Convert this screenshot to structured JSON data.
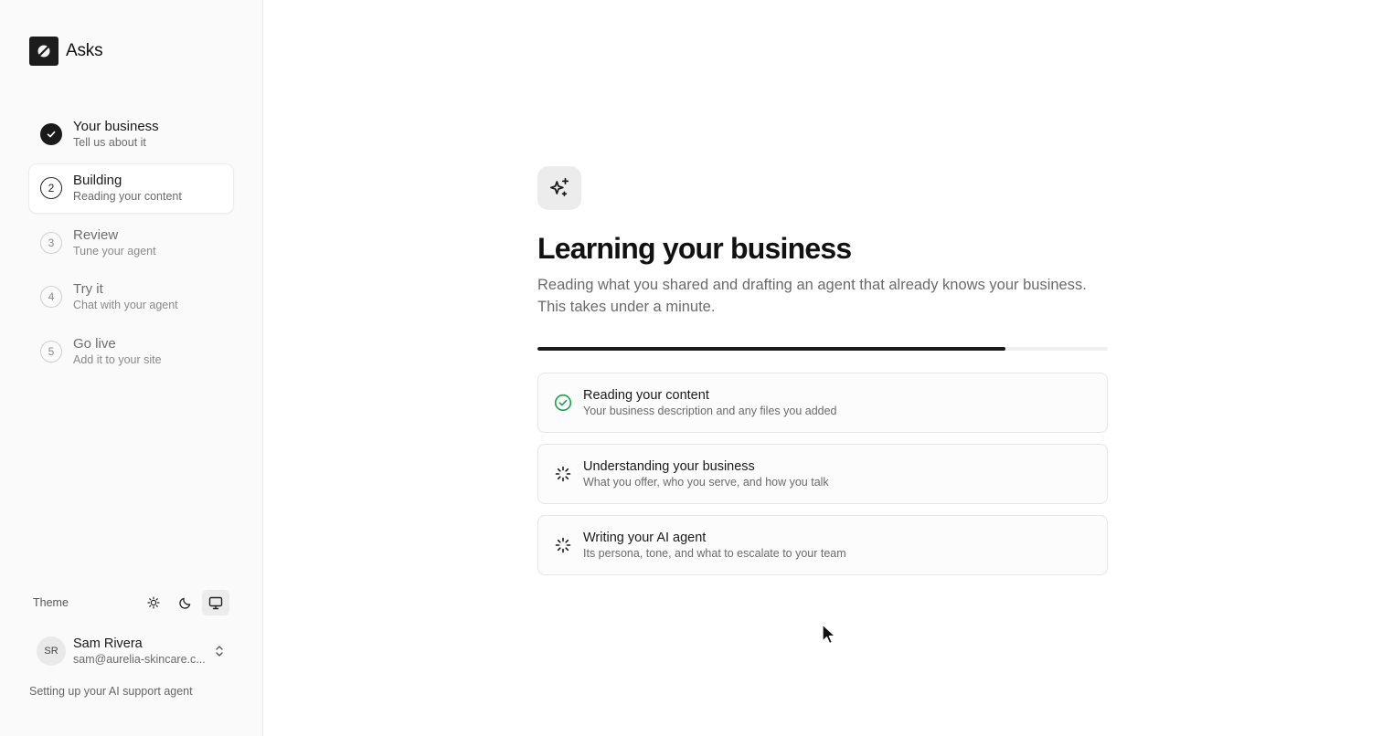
{
  "brand": {
    "name": "Asks",
    "icon": "leaf-logo-icon"
  },
  "steps": [
    {
      "number": "1",
      "title": "Your business",
      "subtitle": "Tell us about it",
      "state": "done"
    },
    {
      "number": "2",
      "title": "Building",
      "subtitle": "Reading your content",
      "state": "current"
    },
    {
      "number": "3",
      "title": "Review",
      "subtitle": "Tune your agent",
      "state": "todo"
    },
    {
      "number": "4",
      "title": "Try it",
      "subtitle": "Chat with your agent",
      "state": "todo"
    },
    {
      "number": "5",
      "title": "Go live",
      "subtitle": "Add it to your site",
      "state": "todo"
    }
  ],
  "theme": {
    "label": "Theme",
    "options": [
      "sun-icon",
      "moon-icon",
      "monitor-icon"
    ],
    "selected": "monitor-icon"
  },
  "user": {
    "initials": "SR",
    "name": "Sam Rivera",
    "email": "sam@aurelia-skincare.c..."
  },
  "footer": {
    "text": "Setting up your AI support agent"
  },
  "main": {
    "icon": "sparkles-icon",
    "title": "Learning your business",
    "subtitle": "Reading what you shared and drafting an agent that already knows your business. This takes under a minute.",
    "progress": 0.82,
    "tasks": [
      {
        "title": "Reading your content",
        "subtitle": "Your business description and any files you added",
        "status": "done"
      },
      {
        "title": "Understanding your business",
        "subtitle": "What you offer, who you serve, and how you talk",
        "status": "loading"
      },
      {
        "title": "Writing your AI agent",
        "subtitle": "Its persona, tone, and what to escalate to your team",
        "status": "loading"
      }
    ]
  },
  "colors": {
    "accent": "#1a1a1a",
    "success": "#16a34a",
    "sidebar_bg": "#fafafa"
  }
}
